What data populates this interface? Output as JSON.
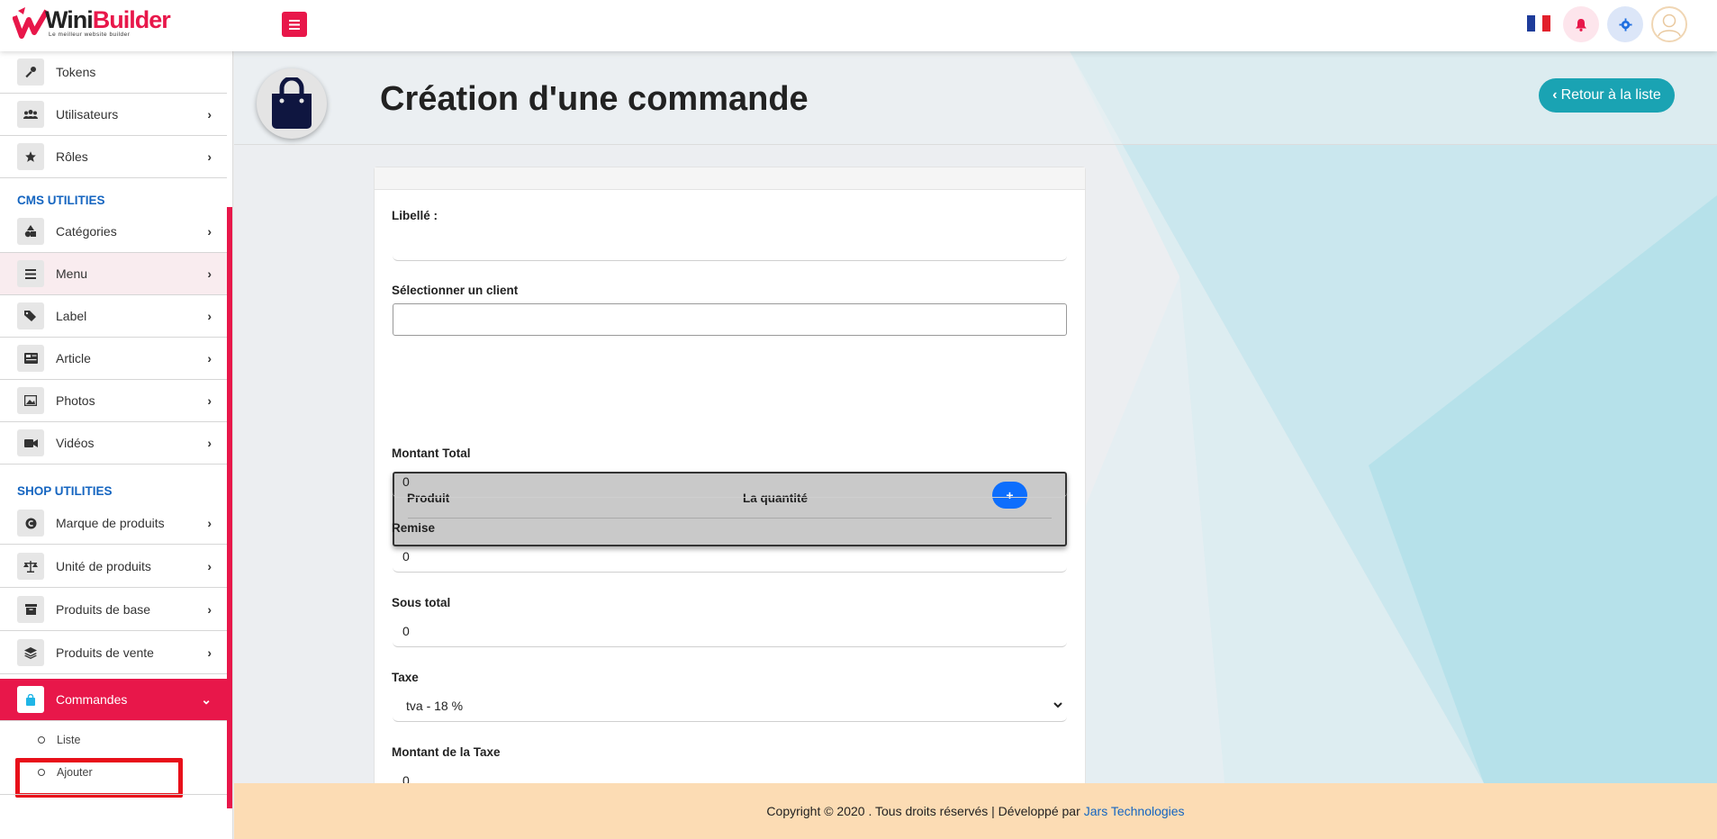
{
  "brand": {
    "logo_text_a": "Wini",
    "logo_text_b": "Builder",
    "logo_tagline": "Le meilleur website builder",
    "accent": "#e8174a"
  },
  "topbar": {
    "menu_icon": "hamburger-icon",
    "language": "fr",
    "notification_icon": "bell-icon",
    "settings_icon": "gear-icon",
    "avatar_icon": "user-icon"
  },
  "sidebar": {
    "items_top": [
      {
        "label": "Tokens",
        "icon": "key-icon",
        "has_chevron": false
      },
      {
        "label": "Utilisateurs",
        "icon": "users-icon",
        "has_chevron": true
      },
      {
        "label": "Rôles",
        "icon": "star-icon",
        "has_chevron": true
      }
    ],
    "section_cms": "CMS UTILITIES",
    "items_cms": [
      {
        "label": "Catégories",
        "icon": "shapes-icon"
      },
      {
        "label": "Menu",
        "icon": "bars-icon"
      },
      {
        "label": "Label",
        "icon": "tags-icon"
      },
      {
        "label": "Article",
        "icon": "newspaper-icon"
      },
      {
        "label": "Photos",
        "icon": "image-icon"
      },
      {
        "label": "Vidéos",
        "icon": "video-icon"
      }
    ],
    "section_shop": "SHOP UTILITIES",
    "items_shop": [
      {
        "label": "Marque de produits",
        "icon": "copyright-icon"
      },
      {
        "label": "Unité de produits",
        "icon": "scale-icon"
      },
      {
        "label": "Produits de base",
        "icon": "archive-icon"
      },
      {
        "label": "Produits de vente",
        "icon": "layers-icon"
      }
    ],
    "active_item": {
      "label": "Commandes",
      "icon": "shopping-bag-icon"
    },
    "sub_items": [
      {
        "label": "Liste"
      },
      {
        "label": "Ajouter"
      }
    ]
  },
  "header": {
    "title": "Création d'une commande",
    "back_button": "Retour à la liste"
  },
  "form": {
    "libelle_label": "Libellé :",
    "libelle_value": "",
    "client_label": "Sélectionner un client",
    "client_value": "",
    "table_col_product": "Produit",
    "table_col_quantity": "La quantité",
    "add_row_label": "+",
    "montant_total_label": "Montant Total",
    "montant_total_value": "0",
    "remise_label": "Remise",
    "remise_value": "0",
    "sous_total_label": "Sous total",
    "sous_total_value": "0",
    "taxe_label": "Taxe",
    "taxe_selected": "tva - 18 %",
    "montant_taxe_label": "Montant de la Taxe",
    "montant_taxe_value": "0"
  },
  "footer": {
    "copyright": "Copyright © 2020 . Tous droits réservés | Développé par",
    "company": "Jars Technologies"
  }
}
